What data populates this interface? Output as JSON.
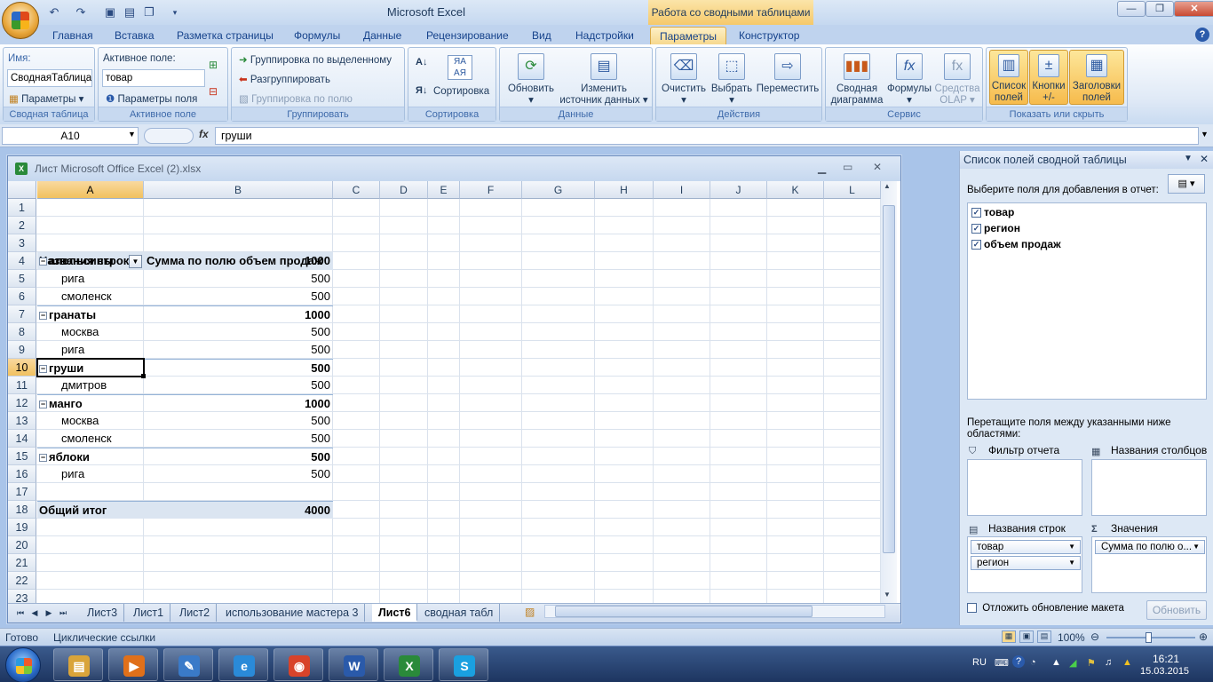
{
  "app": {
    "title": "Microsoft Excel",
    "context_title": "Работа со сводными таблицами"
  },
  "window_buttons": {
    "minimize": "—",
    "restore": "❐",
    "close": "✕"
  },
  "tabs": [
    "Главная",
    "Вставка",
    "Разметка страницы",
    "Формулы",
    "Данные",
    "Рецензирование",
    "Вид",
    "Надстройки",
    "Параметры",
    "Конструктор"
  ],
  "active_tab": "Параметры",
  "ribbon": {
    "pivot_table": {
      "name_label": "Имя:",
      "name_value": "СводнаяТаблица2",
      "params_btn": "Параметры",
      "group": "Сводная таблица"
    },
    "active_field": {
      "label": "Активное поле:",
      "value": "товар",
      "field_params": "Параметры поля",
      "group": "Активное поле"
    },
    "grouping": {
      "group_selection": "Группировка по выделенному",
      "ungroup": "Разгруппировать",
      "group_field": "Группировка по полю",
      "group": "Группировать"
    },
    "sort": {
      "sort_btn": "Сортировка",
      "group": "Сортировка"
    },
    "data": {
      "refresh": "Обновить",
      "change_source_1": "Изменить",
      "change_source_2": "источник данных",
      "group": "Данные"
    },
    "actions": {
      "clear": "Очистить",
      "select": "Выбрать",
      "move": "Переместить",
      "group": "Действия"
    },
    "tools": {
      "chart_1": "Сводная",
      "chart_2": "диаграмма",
      "formulas": "Формулы",
      "olap_1": "Средства",
      "olap_2": "OLAP",
      "group": "Сервис"
    },
    "show_hide": {
      "field_list_1": "Список",
      "field_list_2": "полей",
      "buttons_1": "Кнопки",
      "buttons_2": "+/-",
      "headers_1": "Заголовки",
      "headers_2": "полей",
      "group": "Показать или скрыть"
    }
  },
  "formula_bar": {
    "name_box": "A10",
    "fx": "fx",
    "content": "груши"
  },
  "workbook": {
    "title": "Лист Microsoft Office Excel (2).xlsx",
    "columns": [
      "A",
      "B",
      "C",
      "D",
      "E",
      "F",
      "G",
      "H",
      "I",
      "J",
      "K",
      "L"
    ],
    "selected_column": "A",
    "selected_row": "10",
    "row_numbers": [
      "1",
      "2",
      "3",
      "4",
      "5",
      "6",
      "7",
      "8",
      "9",
      "10",
      "11",
      "12",
      "13",
      "14",
      "15",
      "16",
      "17",
      "18",
      "19",
      "20",
      "21",
      "22",
      "23"
    ],
    "pivot_header": {
      "rows": "Названия строк",
      "values": "Сумма по полю объем продаж"
    },
    "pivot_rows": [
      {
        "row": 4,
        "label": "апельсины",
        "value": "1000",
        "level": 0
      },
      {
        "row": 5,
        "label": "рига",
        "value": "500",
        "level": 1
      },
      {
        "row": 6,
        "label": "смоленск",
        "value": "500",
        "level": 1
      },
      {
        "row": 7,
        "label": "гранаты",
        "value": "1000",
        "level": 0
      },
      {
        "row": 8,
        "label": "москва",
        "value": "500",
        "level": 1
      },
      {
        "row": 9,
        "label": "рига",
        "value": "500",
        "level": 1
      },
      {
        "row": 10,
        "label": "груши",
        "value": "500",
        "level": 0
      },
      {
        "row": 11,
        "label": "дмитров",
        "value": "500",
        "level": 1
      },
      {
        "row": 12,
        "label": "манго",
        "value": "1000",
        "level": 0
      },
      {
        "row": 13,
        "label": "москва",
        "value": "500",
        "level": 1
      },
      {
        "row": 14,
        "label": "смоленск",
        "value": "500",
        "level": 1
      },
      {
        "row": 15,
        "label": "яблоки",
        "value": "500",
        "level": 0
      },
      {
        "row": 16,
        "label": "рига",
        "value": "500",
        "level": 1
      }
    ],
    "grand_total": {
      "label": "Общий итог",
      "value": "4000"
    },
    "sheet_tabs": [
      "Лист3",
      "Лист1",
      "Лист2",
      "использование мастера 3",
      "Лист6",
      "сводная табл"
    ],
    "active_sheet": "Лист6"
  },
  "pivot_pane": {
    "title": "Список полей сводной таблицы",
    "choose_label": "Выберите поля для добавления в отчет:",
    "fields": [
      {
        "name": "товар",
        "checked": true
      },
      {
        "name": "регион",
        "checked": true
      },
      {
        "name": "объем продаж",
        "checked": true
      }
    ],
    "drag_label": "Перетащите поля между указанными ниже областями:",
    "areas": {
      "filter": "Фильтр отчета",
      "columns": "Названия столбцов",
      "rows": "Названия строк",
      "values": "Значения"
    },
    "row_fields": [
      "товар",
      "регион"
    ],
    "value_fields": [
      "Сумма по полю о..."
    ],
    "defer_label": "Отложить обновление макета",
    "update_btn": "Обновить"
  },
  "status_bar": {
    "ready": "Готово",
    "circular": "Циклические ссылки",
    "zoom": "100%"
  },
  "taskbar": {
    "lang": "RU",
    "time": "16:21",
    "date": "15.03.2015",
    "apps": [
      {
        "name": "explorer",
        "glyph": "▤",
        "color": "#d9a43a"
      },
      {
        "name": "media-player",
        "glyph": "▶",
        "color": "#e0701a"
      },
      {
        "name": "paint",
        "glyph": "✎",
        "color": "#3a7ac8"
      },
      {
        "name": "internet-explorer",
        "glyph": "e",
        "color": "#2a8ad8"
      },
      {
        "name": "chrome",
        "glyph": "◉",
        "color": "#d8432a"
      },
      {
        "name": "word",
        "glyph": "W",
        "color": "#2a5aaa"
      },
      {
        "name": "excel",
        "glyph": "X",
        "color": "#2a8a3a"
      },
      {
        "name": "skype",
        "glyph": "S",
        "color": "#1aa0e0"
      }
    ]
  }
}
